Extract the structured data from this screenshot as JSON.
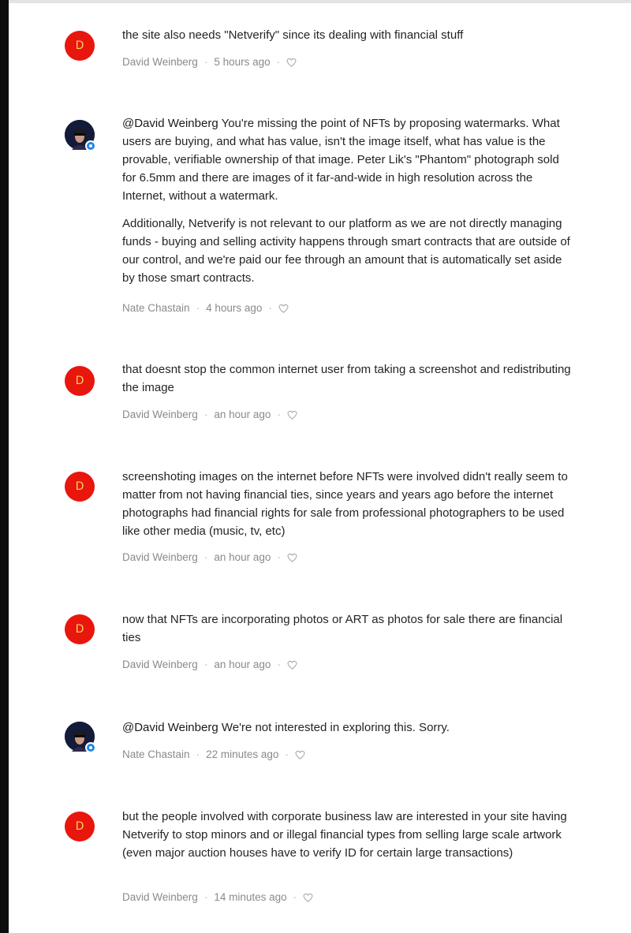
{
  "icons": {
    "avatar": "avatar-icon",
    "verified": "verified-badge-icon",
    "like": "heart-icon"
  },
  "colors": {
    "avatar_red": "#e8160c",
    "badge_blue": "#1e88e5",
    "meta_gray": "#8a8a8a"
  },
  "comments": [
    {
      "avatar_letter": "D",
      "paragraphs": [
        "the site also needs \"Netverify\" since its dealing with financial stuff"
      ],
      "author": "David Weinberg",
      "time": "5 hours ago"
    },
    {
      "mention": "@David Weinberg",
      "paragraphs": [
        "You're missing the point of NFTs by proposing watermarks. What users are buying, and what has value, isn't the image itself, what has value is the provable, verifiable ownership of that image. Peter Lik's \"Phantom\" photograph sold for 6.5mm and there are images of it far-and-wide in high resolution across the Internet, without a watermark.",
        "Additionally, Netverify is not relevant to our platform as we are not directly managing funds - buying and selling activity happens through smart contracts that are outside of our control, and we're paid our fee through an amount that is automatically set aside by those smart contracts."
      ],
      "author": "Nate Chastain",
      "time": "4 hours ago"
    },
    {
      "avatar_letter": "D",
      "paragraphs": [
        "that doesnt stop the common internet user from taking a screenshot and redistributing the image"
      ],
      "author": "David Weinberg",
      "time": "an hour ago"
    },
    {
      "avatar_letter": "D",
      "paragraphs": [
        "screenshoting images on the internet before NFTs were involved didn't really seem to matter from not having financial ties, since years and years ago before the internet photographs had financial rights for sale from professional photographers to be used like other media (music, tv, etc)"
      ],
      "author": "David Weinberg",
      "time": "an hour ago"
    },
    {
      "avatar_letter": "D",
      "paragraphs": [
        "now that NFTs are incorporating photos or ART as photos for sale there are financial ties"
      ],
      "author": "David Weinberg",
      "time": "an hour ago"
    },
    {
      "mention": "@David Weinberg",
      "paragraphs": [
        "We're not interested in exploring this. Sorry."
      ],
      "author": "Nate Chastain",
      "time": "22 minutes ago"
    },
    {
      "avatar_letter": "D",
      "paragraphs": [
        "but the people involved with corporate business law are interested in your site having Netverify to stop minors and or illegal financial types from selling large scale artwork (even major auction houses have to verify ID for certain large transactions)"
      ],
      "author": "David Weinberg",
      "time": "14 minutes ago"
    }
  ]
}
